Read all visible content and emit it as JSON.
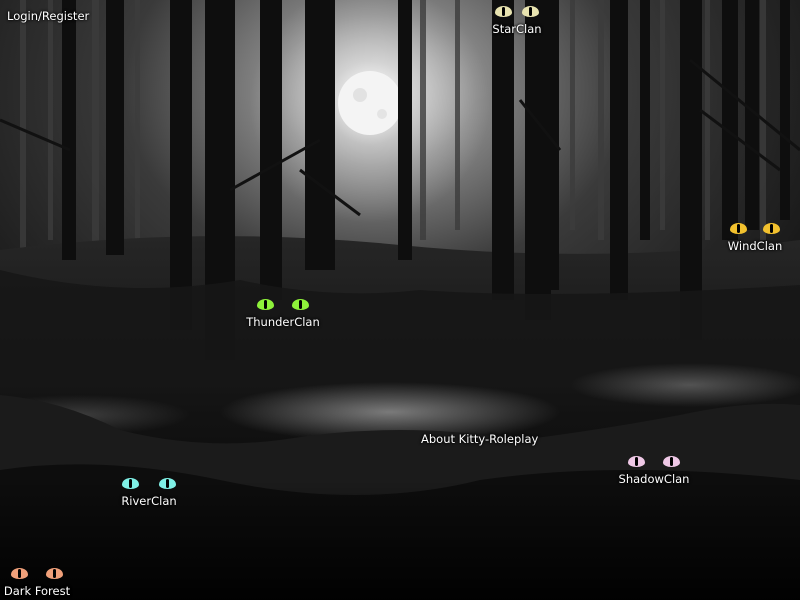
{
  "nav": {
    "login_register": "Login/Register",
    "about": "About Kitty-Roleplay"
  },
  "clans": [
    {
      "id": "starclan",
      "label": "StarClan",
      "eye_color": "#e8e3b0"
    },
    {
      "id": "windclan",
      "label": "WindClan",
      "eye_color": "#f2c12e"
    },
    {
      "id": "thunderclan",
      "label": "ThunderClan",
      "eye_color": "#8ef23a"
    },
    {
      "id": "riverclan",
      "label": "RiverClan",
      "eye_color": "#7ff0e6"
    },
    {
      "id": "shadowclan",
      "label": "ShadowClan",
      "eye_color": "#efc8e6"
    },
    {
      "id": "darkforest",
      "label": "Dark Forest",
      "eye_color": "#f0a07a"
    }
  ]
}
